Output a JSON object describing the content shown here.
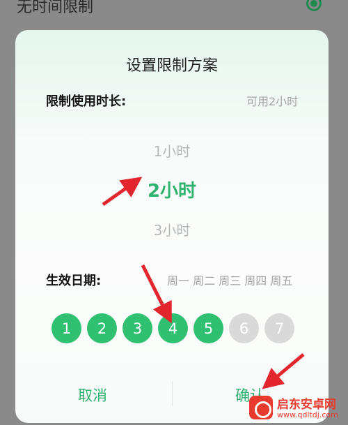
{
  "background_row": {
    "label": "无时间限制"
  },
  "dialog": {
    "title": "设置限制方案",
    "duration": {
      "label": "限制使用时长:",
      "hint": "可用2小时",
      "options": [
        "1小时",
        "2小时",
        "3小时"
      ],
      "selected_index": 1
    },
    "effective_date": {
      "label": "生效日期:",
      "summary": "周一 周二 周三 周四 周五",
      "days": [
        {
          "label": "1",
          "active": true
        },
        {
          "label": "2",
          "active": true
        },
        {
          "label": "3",
          "active": true
        },
        {
          "label": "4",
          "active": true
        },
        {
          "label": "5",
          "active": true
        },
        {
          "label": "6",
          "active": false
        },
        {
          "label": "7",
          "active": false
        }
      ]
    },
    "buttons": {
      "cancel": "取消",
      "confirm": "确认"
    }
  },
  "watermark": {
    "title": "启东安卓网",
    "url": "www.qdltdj.com"
  },
  "colors": {
    "accent": "#2fc072",
    "accent_text": "#2fb16f",
    "arrow": "#e3262e",
    "inactive": "#d9d9d9"
  }
}
